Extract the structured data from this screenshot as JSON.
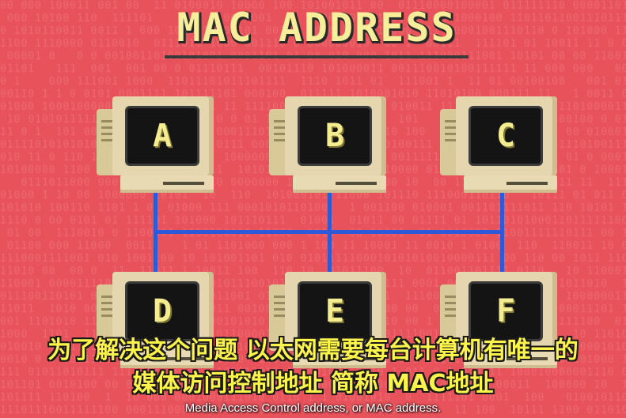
{
  "scene": {
    "title": "MAC ADDRESS",
    "background_color": "#e8525a",
    "wire_color": "#2d5ad8",
    "computers": [
      "A",
      "B",
      "C",
      "D",
      "E",
      "F"
    ]
  },
  "subtitles": {
    "line1": "为了解决这个问题 以太网需要每台计算机有唯一的",
    "line2": "媒体访问控制地址 简称 MAC地址",
    "english": "Media Access Control address, or MAC address."
  }
}
